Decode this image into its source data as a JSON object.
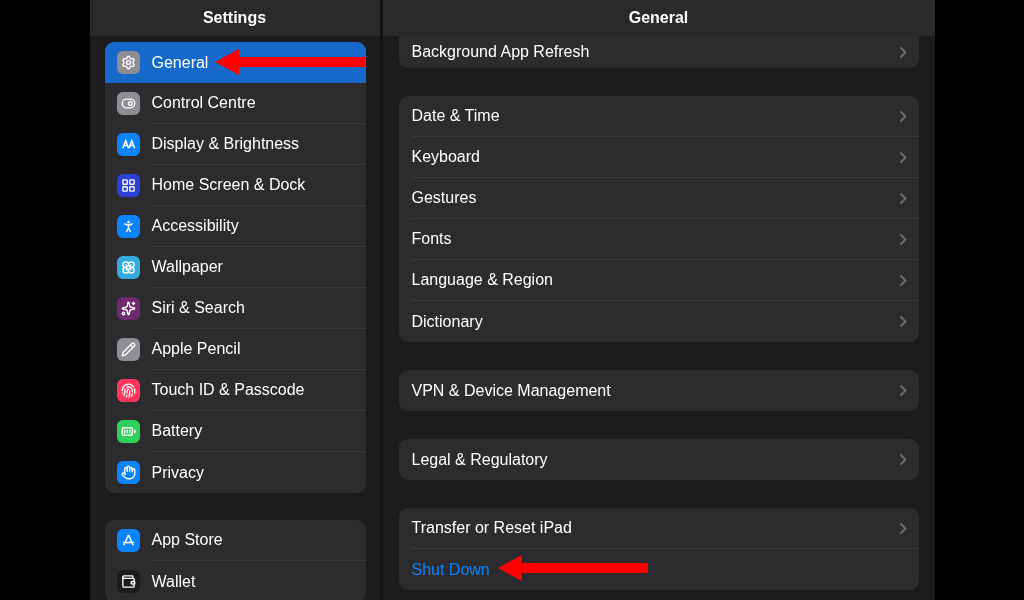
{
  "sidebar": {
    "title": "Settings",
    "groups": [
      {
        "items": [
          {
            "label": "General",
            "selected": true,
            "color": "#8e8e93"
          },
          {
            "label": "Control Centre",
            "selected": false,
            "color": "#8e8e93"
          },
          {
            "label": "Display & Brightness",
            "selected": false,
            "color": "#0a84ff"
          },
          {
            "label": "Home Screen & Dock",
            "selected": false,
            "color": "#2c3fd6"
          },
          {
            "label": "Accessibility",
            "selected": false,
            "color": "#0a84ff"
          },
          {
            "label": "Wallpaper",
            "selected": false,
            "color": "#35aadc"
          },
          {
            "label": "Siri & Search",
            "selected": false,
            "color": "#6e2a6e"
          },
          {
            "label": "Apple Pencil",
            "selected": false,
            "color": "#8e8e93"
          },
          {
            "label": "Touch ID & Passcode",
            "selected": false,
            "color": "#ff375f"
          },
          {
            "label": "Battery",
            "selected": false,
            "color": "#30d158"
          },
          {
            "label": "Privacy",
            "selected": false,
            "color": "#0a84ff"
          }
        ]
      },
      {
        "items": [
          {
            "label": "App Store",
            "selected": false,
            "color": "#0a84ff"
          },
          {
            "label": "Wallet",
            "selected": false,
            "color": "#1c1c1e"
          }
        ]
      }
    ]
  },
  "detail": {
    "title": "General",
    "groups": [
      {
        "cut": true,
        "rows": [
          {
            "label": "Background App Refresh",
            "kind": "link"
          }
        ]
      },
      {
        "rows": [
          {
            "label": "Date & Time",
            "kind": "link"
          },
          {
            "label": "Keyboard",
            "kind": "link"
          },
          {
            "label": "Gestures",
            "kind": "link"
          },
          {
            "label": "Fonts",
            "kind": "link"
          },
          {
            "label": "Language & Region",
            "kind": "link"
          },
          {
            "label": "Dictionary",
            "kind": "link"
          }
        ]
      },
      {
        "rows": [
          {
            "label": "VPN & Device Management",
            "kind": "link"
          }
        ]
      },
      {
        "rows": [
          {
            "label": "Legal & Regulatory",
            "kind": "link"
          }
        ]
      },
      {
        "rows": [
          {
            "label": "Transfer or Reset iPad",
            "kind": "link"
          },
          {
            "label": "Shut Down",
            "kind": "action"
          }
        ]
      }
    ]
  }
}
